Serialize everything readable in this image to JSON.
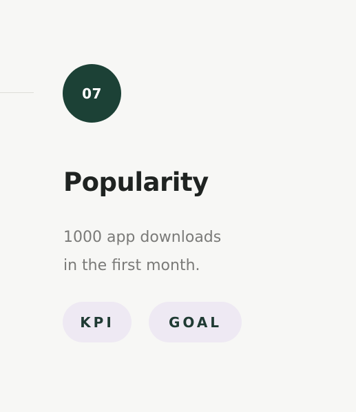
{
  "step": {
    "number": "07"
  },
  "card": {
    "title": "Popularity",
    "description_line1": "1000 app downloads",
    "description_line2": "in the first month."
  },
  "tags": [
    {
      "label": "KPI"
    },
    {
      "label": "GOAL"
    }
  ],
  "colors": {
    "background": "#f7f7f5",
    "circle": "#1c4136",
    "tag_background": "#eee9f3",
    "tag_text": "#1f3a33",
    "title_text": "#1f2321",
    "description_text": "#7a7a78"
  }
}
